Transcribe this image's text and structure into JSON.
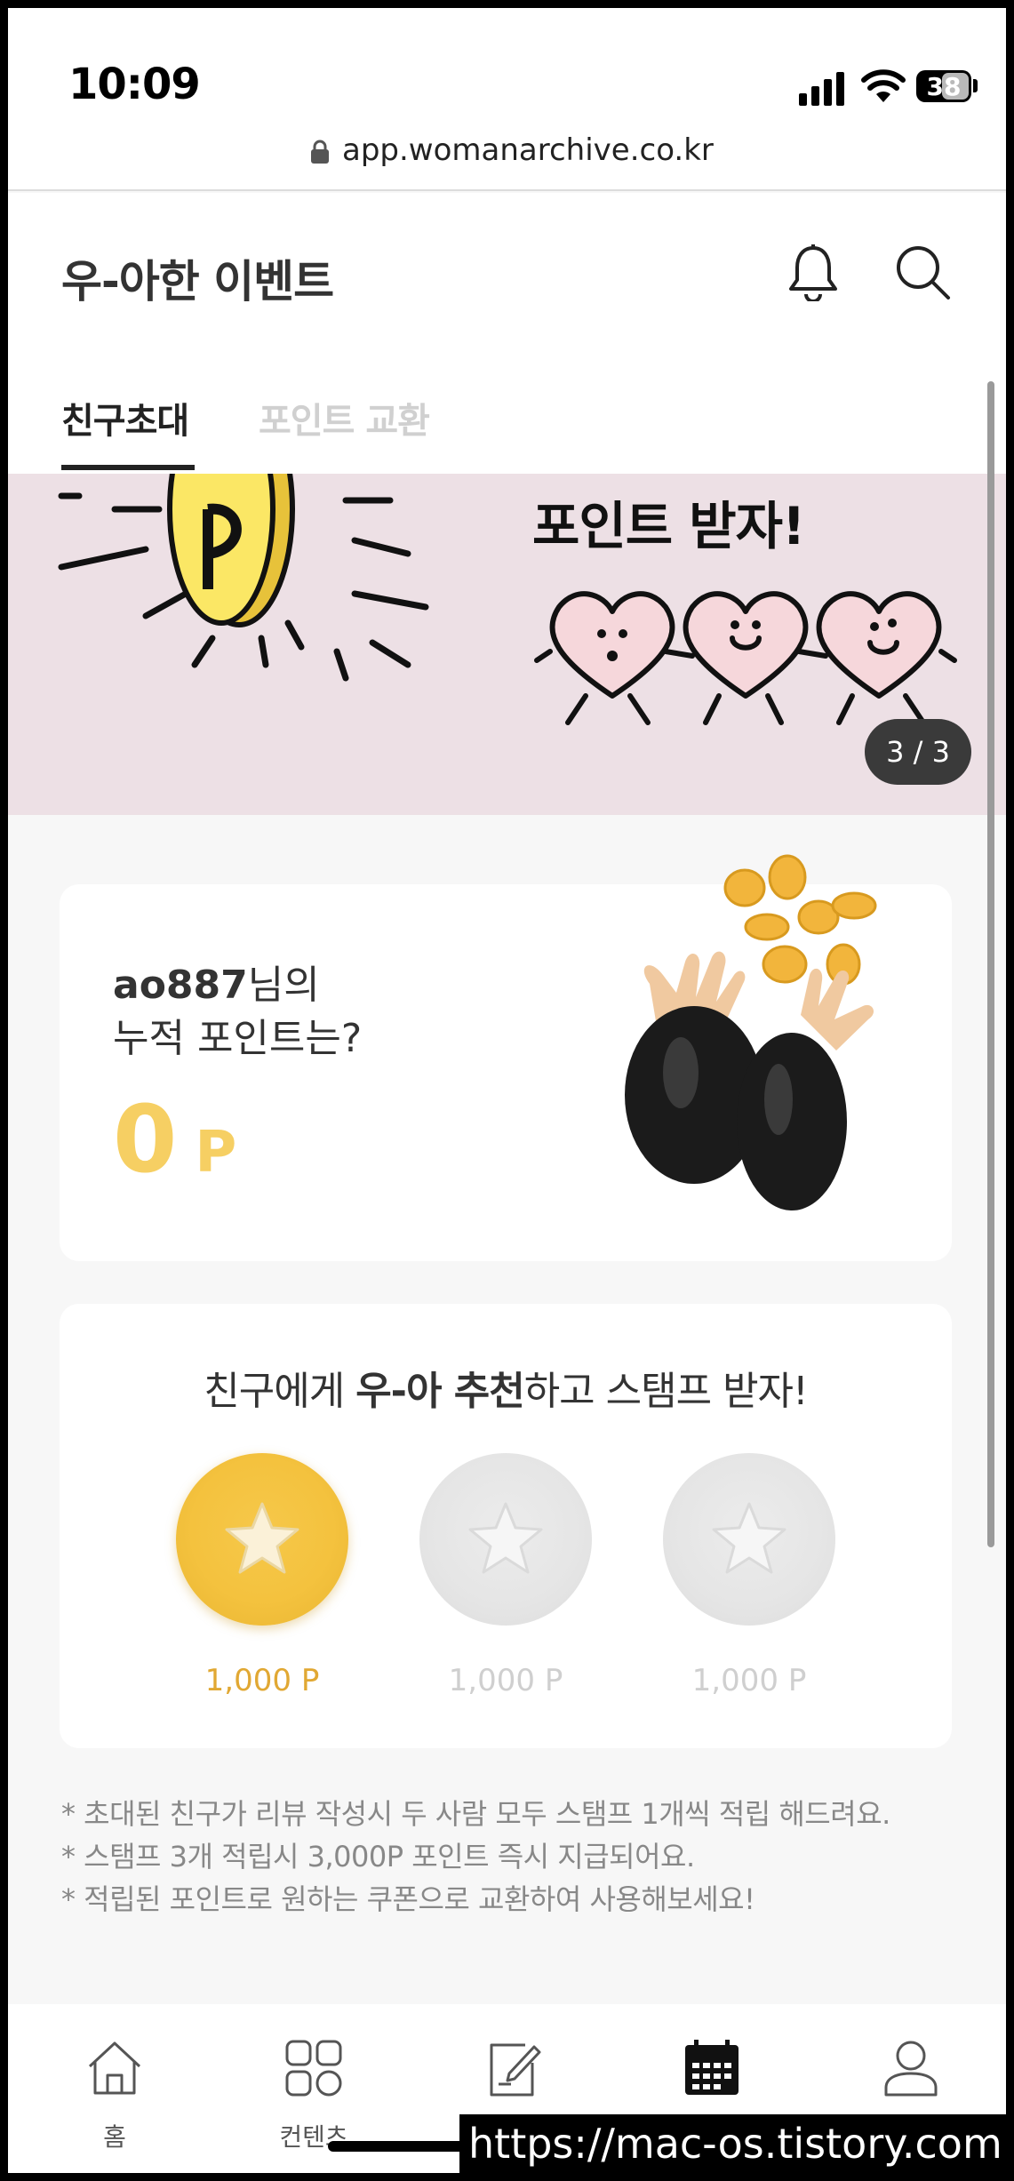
{
  "status_bar": {
    "time": "10:09",
    "battery": "38"
  },
  "browser": {
    "url": "app.womanarchive.co.kr"
  },
  "header": {
    "title": "우-아한 이벤트"
  },
  "tabs": [
    {
      "label": "친구초대",
      "active": true
    },
    {
      "label": "포인트 교환",
      "active": false
    }
  ],
  "banner": {
    "headline": "포인트 받자!",
    "pager": "3 / 3"
  },
  "points_card": {
    "username": "ao887",
    "suffix": "님의",
    "question": "누적 포인트는?",
    "value": "0",
    "unit": "P"
  },
  "stamp_card": {
    "prefix": "친구에게 ",
    "emphasis": "우-아 추천",
    "suffix": "하고 스탬프 받자!",
    "stamps": [
      {
        "label": "1,000 P",
        "earned": true
      },
      {
        "label": "1,000 P",
        "earned": false
      },
      {
        "label": "1,000 P",
        "earned": false
      }
    ]
  },
  "notes": [
    "* 초대된 친구가 리뷰 작성시 두 사람 모두 스탬프 1개씩 적립 해드려요.",
    "* 스탬프 3개 적립시 3,000P 포인트 즉시 지급되어요.",
    "* 적립된 포인트로 원하는 쿠폰으로 교환하여 사용해보세요!"
  ],
  "bottom_nav": [
    {
      "label": "홈",
      "icon": "home-icon"
    },
    {
      "label": "컨텐츠",
      "icon": "grid-icon"
    },
    {
      "label": "",
      "icon": "edit-icon"
    },
    {
      "label": "",
      "icon": "calendar-icon"
    },
    {
      "label": "",
      "icon": "user-icon"
    }
  ],
  "watermark": "https://mac-os.tistory.com",
  "colors": {
    "accent": "#f6cf63",
    "stamp_label": "#e1a833",
    "banner_bg": "#ede0e5"
  }
}
